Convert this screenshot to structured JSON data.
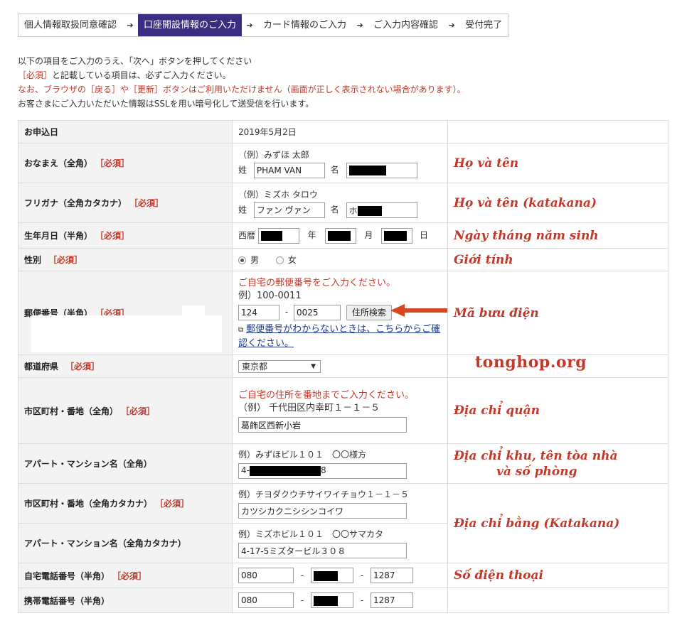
{
  "steps": [
    {
      "label": "個人情報取扱同意確認",
      "active": false
    },
    {
      "label": "口座開設情報のご入力",
      "active": true
    },
    {
      "label": "カード情報のご入力",
      "active": false
    },
    {
      "label": "ご入力内容確認",
      "active": false
    },
    {
      "label": "受付完了",
      "active": false
    }
  ],
  "step_arrow_glyph": "➔",
  "instructions": {
    "line1": "以下の項目をご入力のうえ、「次へ」ボタンを押してください",
    "line2_req": "［必須］",
    "line2_rest": "と記載している項目は、必ずご入力ください。",
    "line3": "なお、ブラウザの［戻る］や［更新］ボタンはご利用いただけません（画面が正しく表示されない場合があります）。",
    "line4": "お客さまにご入力いただいた情報はSSLを用い暗号化して送受信を行います。"
  },
  "required_tag": "［必須］",
  "rows": {
    "date": {
      "label": "お申込日",
      "value": "2019年5月2日"
    },
    "name": {
      "label": "おなまえ（全角）",
      "example": "（例）みずほ 太郎",
      "sei_label": "姓",
      "sei_value": "PHAM VAN",
      "mei_label": "名",
      "note": "Họ và tên"
    },
    "furigana": {
      "label": "フリガナ（全角カタカナ）",
      "example": "（例）ミズホ タロウ",
      "sei_label": "姓",
      "sei_value": "ファン ヴァン",
      "mei_label": "名",
      "mei_value": "ホ",
      "note": "Họ và tên (katakana)"
    },
    "birth": {
      "label": "生年月日（半角）",
      "era": "西暦",
      "year": "年",
      "month": "月",
      "day": "日",
      "note": "Ngày tháng năm sinh"
    },
    "gender": {
      "label": "性別",
      "male": "男",
      "female": "女",
      "note": "Giới tính"
    },
    "postal": {
      "label": "郵便番号（半角）",
      "msg": "ご自宅の郵便番号をご入力ください。",
      "example": "例）100-0011",
      "zip1": "124",
      "dash": "-",
      "zip2": "0025",
      "search_btn": "住所検索",
      "link_icon": "⧉",
      "link": "郵便番号がわからないときは、こちらからご確認ください。",
      "note": "Mã bưu điện"
    },
    "pref": {
      "label": "都道府県",
      "selected": "東京都",
      "caret": "▼"
    },
    "city": {
      "label": "市区町村・番地（全角）",
      "msg": "ご自宅の住所を番地までご入力ください。",
      "example": "（例） 千代田区内幸町１－１－５",
      "value": "葛飾区西新小岩",
      "note": "Địa chỉ quận"
    },
    "apt": {
      "label": "アパート・マンション名（全角）",
      "example": "例）みずほビル１０１　〇〇様方",
      "value_prefix": "4-",
      "value_suffix": "8",
      "note_l1": "Địa chỉ khu, tên tòa nhà",
      "note_l2": "và số phòng"
    },
    "city_kana": {
      "label": "市区町村・番地（全角カタカナ）",
      "example": "例）チヨダクウチサイワイチョウ１－１－５",
      "value": "カツシカクニシシンコイワ"
    },
    "apt_kana": {
      "label": "アパート・マンション名（全角カタカナ）",
      "example": "例）ミズホビル１０１　〇〇サマカタ",
      "value": "4-17-5ミズタービル３０８"
    },
    "address_kana_note": "Địa chỉ bằng (Katakana)",
    "home_tel": {
      "label": "自宅電話番号（半角）",
      "p1": "080",
      "p3": "1287",
      "dash": "-",
      "note": "Số điện thoại"
    },
    "mobile_tel": {
      "label": "携帯電話番号（半角）",
      "p1": "080",
      "p3": "1287",
      "dash": "-"
    }
  },
  "watermark": "tonghop.org"
}
